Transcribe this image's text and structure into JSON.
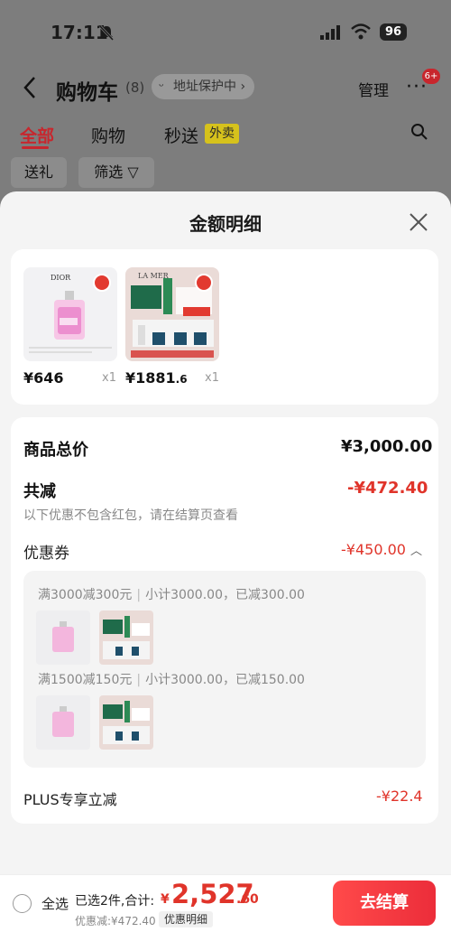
{
  "status_bar": {
    "time": "17:11",
    "battery": "96"
  },
  "header": {
    "title": "购物车",
    "count": "(8)",
    "address_protect": "地址保护中",
    "manage": "管理",
    "more": "···",
    "notification_badge": "6+"
  },
  "tabs": [
    {
      "label": "全部"
    },
    {
      "label": "购物"
    },
    {
      "label": "秒送"
    }
  ],
  "tab_tag": "外卖",
  "chips": [
    {
      "label": "送礼"
    },
    {
      "label": "筛选"
    }
  ],
  "sheet": {
    "title": "金额明细",
    "products": [
      {
        "name": "DIOR",
        "price": "¥646",
        "price_decimal": "",
        "qty": "x1"
      },
      {
        "name": "LA MER",
        "price": "¥1881",
        "price_decimal": ".6",
        "qty": "x1"
      }
    ],
    "total_label": "商品总价",
    "total_value": "¥3,000.00",
    "reduce_label": "共减",
    "reduce_value": "-¥472.40",
    "reduce_note": "以下优惠不包含红包，请在结算页查看",
    "coupon_label": "优惠券",
    "coupon_value": "-¥450.00",
    "coupon_groups": [
      {
        "rule": "满3000减300元",
        "detail": "小计3000.00，已减300.00"
      },
      {
        "rule": "满1500减150元",
        "detail": "小计3000.00，已减150.00"
      }
    ],
    "plus_label": "PLUS专享立减",
    "plus_value": "-¥22.4"
  },
  "bottom": {
    "select_all": "全选",
    "selected_text": "已选2件,合计:",
    "currency": "¥",
    "total_int": "2,527",
    "total_dec": ".60",
    "discount_text": "优惠减:¥472.40",
    "detail_chip": "优惠明细",
    "checkout": "去结算"
  },
  "colors": {
    "accent": "#e0342a",
    "checkout": "#ec2d3a",
    "tab_tag": "#d6c21c"
  }
}
